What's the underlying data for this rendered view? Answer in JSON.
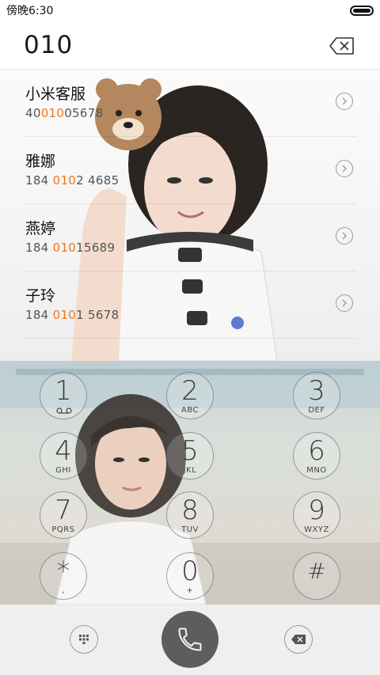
{
  "status_bar": {
    "time": "傍晚6:30"
  },
  "dialer": {
    "number": "010"
  },
  "contacts": [
    {
      "name": "小米客服",
      "number_pre": "40",
      "number_match": "010",
      "number_post": "05678"
    },
    {
      "name": "雅娜",
      "number_pre": "184 ",
      "number_match": "010",
      "number_post": "2 4685"
    },
    {
      "name": "燕婷",
      "number_pre": "184 ",
      "number_match": "010",
      "number_post": "15689"
    },
    {
      "name": "子玲",
      "number_pre": "184 ",
      "number_match": "010",
      "number_post": "1 5678"
    }
  ],
  "keypad": [
    {
      "digit": "1",
      "letters": ""
    },
    {
      "digit": "2",
      "letters": "ABC"
    },
    {
      "digit": "3",
      "letters": "DEF"
    },
    {
      "digit": "4",
      "letters": "GHI"
    },
    {
      "digit": "5",
      "letters": "JKL"
    },
    {
      "digit": "6",
      "letters": "MNO"
    },
    {
      "digit": "7",
      "letters": "PQRS"
    },
    {
      "digit": "8",
      "letters": "TUV"
    },
    {
      "digit": "9",
      "letters": "WXYZ"
    },
    {
      "digit": "*",
      "letters": ","
    },
    {
      "digit": "0",
      "letters": "+"
    },
    {
      "digit": "#",
      "letters": ""
    }
  ],
  "colors": {
    "highlight": "#f07520",
    "call_button": "#5d5d5d"
  },
  "icons": {
    "voicemail": "voicemail-icon",
    "backspace": "backspace-icon",
    "keypad_toggle": "dialpad-icon",
    "call": "phone-icon",
    "contact_detail": "chevron-right-icon"
  }
}
